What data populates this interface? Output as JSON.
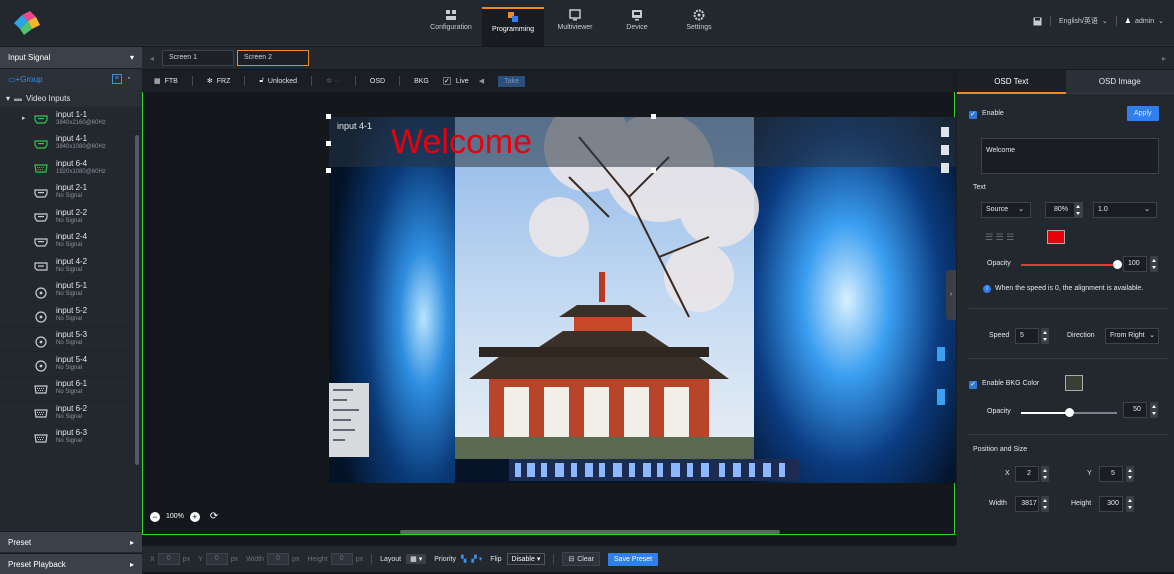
{
  "nav": {
    "items": [
      "Configuration",
      "Programming",
      "Multiviewer",
      "Device",
      "Settings"
    ],
    "language": "English/英语",
    "user": "admin"
  },
  "left": {
    "header": "Input Signal",
    "group_label": "Group",
    "tree_root": "Video Inputs",
    "inputs": [
      {
        "name": "input 1-1",
        "sub": "3840x2160@60Hz",
        "icon": "hdmi-icon",
        "active": true
      },
      {
        "name": "input 4-1",
        "sub": "3840x1080@60Hz",
        "icon": "hdmi-icon",
        "active": true
      },
      {
        "name": "input 6-4",
        "sub": "1920x1080@60Hz",
        "icon": "dvi-icon",
        "active": true
      },
      {
        "name": "input 2-1",
        "sub": "No Signal",
        "icon": "hdmi-icon",
        "active": false
      },
      {
        "name": "input 2-2",
        "sub": "No Signal",
        "icon": "hdmi-icon",
        "active": false
      },
      {
        "name": "input 2-4",
        "sub": "No Signal",
        "icon": "hdmi-icon",
        "active": false
      },
      {
        "name": "input 4-2",
        "sub": "No Signal",
        "icon": "dp-icon",
        "active": false
      },
      {
        "name": "input 5-1",
        "sub": "No Signal",
        "icon": "sdi-icon",
        "active": false
      },
      {
        "name": "input 5-2",
        "sub": "No Signal",
        "icon": "sdi-icon",
        "active": false
      },
      {
        "name": "input 5-3",
        "sub": "No Signal",
        "icon": "sdi-icon",
        "active": false
      },
      {
        "name": "input 5-4",
        "sub": "No Signal",
        "icon": "sdi-icon",
        "active": false
      },
      {
        "name": "input 6-1",
        "sub": "No Signal",
        "icon": "dvi-icon",
        "active": false
      },
      {
        "name": "input 6-2",
        "sub": "No Signal",
        "icon": "dvi-icon",
        "active": false
      },
      {
        "name": "input 6-3",
        "sub": "No Signal",
        "icon": "dvi-icon",
        "active": false
      }
    ],
    "preset": "Preset",
    "preset_playback": "Preset Playback"
  },
  "screens": [
    "Screen 1",
    "Screen 2"
  ],
  "toolbar": {
    "ftb": "FTB",
    "frz": "FRZ",
    "lock": "Unlocked",
    "osd": "OSD",
    "bkg": "BKG",
    "live": "Live",
    "take": "Take"
  },
  "canvas": {
    "layer_label": "input 4-1",
    "welcome": "Welcome",
    "zoom": "100%"
  },
  "bottom": {
    "x_label": "X",
    "x_val": "0",
    "y_label": "Y",
    "y_val": "0",
    "w_label": "Width",
    "w_val": "0",
    "h_label": "Height",
    "h_val": "0",
    "unit": "px",
    "layout": "Layout",
    "priority": "Priority",
    "flip": "Flip",
    "flip_val": "Disable",
    "clear": "Clear",
    "save_preset": "Save Preset"
  },
  "osd": {
    "tab_text": "OSD Text",
    "tab_image": "OSD Image",
    "enable": "Enable",
    "apply": "Apply",
    "text_value": "Welcome",
    "text_section": "Text",
    "source": "Source",
    "font_size": "80%",
    "line_spacing": "1.0",
    "text_color": "#e8000b",
    "opacity_label": "Opacity",
    "opacity_val": "100",
    "opacity_fraction": 1.0,
    "info": "When the speed is 0, the alignment is available.",
    "speed_label": "Speed",
    "speed_val": "5",
    "direction_label": "Direction",
    "direction_val": "From Right",
    "enable_bkg": "Enable BKG Color",
    "bkg_opacity_label": "Opacity",
    "bkg_opacity_val": "50",
    "bkg_opacity_fraction": 0.5,
    "pos_section": "Position and Size",
    "x_label": "X",
    "x_val": "2",
    "y_label": "Y",
    "y_val": "5",
    "w_label": "Width",
    "w_val": "3817",
    "h_label": "Height",
    "h_val": "300"
  },
  "colors": {
    "accent": "#f08a20",
    "blue": "#2f7ff0",
    "select": "#35d235"
  }
}
